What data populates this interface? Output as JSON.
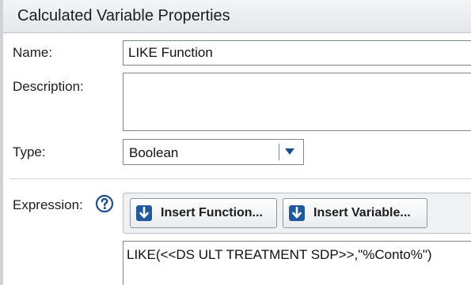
{
  "dialog": {
    "title": "Calculated Variable Properties"
  },
  "form": {
    "name_label": "Name:",
    "name_value": "LIKE Function",
    "description_label": "Description:",
    "description_value": "",
    "type_label": "Type:",
    "type_value": "Boolean",
    "expression_label": "Expression:",
    "expression_value": "LIKE(<<DS ULT TREATMENT SDP>>,\"%Conto%\")"
  },
  "toolbar": {
    "insert_function_label": "Insert Function...",
    "insert_variable_label": "Insert Variable..."
  },
  "icons": {
    "help": "help-circle-icon",
    "insert_function": "insert-arrow-icon",
    "insert_variable": "insert-arrow-icon",
    "dropdown": "chevron-down-icon"
  },
  "colors": {
    "accent": "#1f4e8c",
    "title_bar": "#e8eaed"
  }
}
